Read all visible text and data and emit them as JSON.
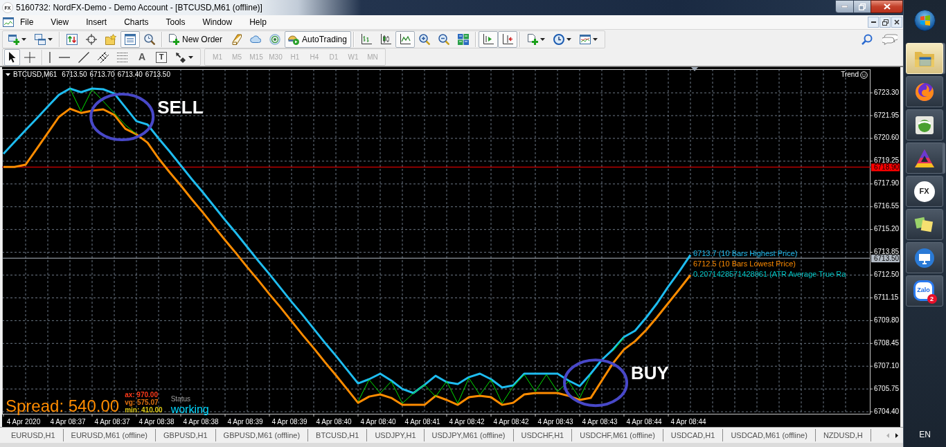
{
  "title_bar": {
    "logo_text": "FX",
    "title": "5160732: NordFX-Demo - Demo Account - [BTCUSD,M61 (offline)]"
  },
  "menu": [
    "File",
    "View",
    "Insert",
    "Charts",
    "Tools",
    "Window",
    "Help"
  ],
  "toolbar": [
    {
      "kind": "icon",
      "pressed": false,
      "dropdown": true
    },
    {
      "kind": "icon",
      "pressed": false,
      "dropdown": true
    },
    {
      "kind": "separator"
    },
    {
      "kind": "icon",
      "pressed": false
    },
    {
      "kind": "icon",
      "pressed": false
    },
    {
      "kind": "icon",
      "pressed": false
    },
    {
      "kind": "icon",
      "pressed": true
    },
    {
      "kind": "icon",
      "pressed": false
    },
    {
      "kind": "separator"
    },
    {
      "kind": "button",
      "label": "New Order",
      "pressed": false
    },
    {
      "kind": "icon",
      "pressed": false
    },
    {
      "kind": "icon",
      "pressed": false
    },
    {
      "kind": "icon",
      "pressed": false
    },
    {
      "kind": "button",
      "label": "AutoTrading",
      "pressed": true
    },
    {
      "kind": "separator"
    },
    {
      "kind": "icon",
      "pressed": false
    },
    {
      "kind": "icon",
      "pressed": false
    },
    {
      "kind": "icon",
      "pressed": true
    },
    {
      "kind": "icon",
      "pressed": false
    },
    {
      "kind": "icon",
      "pressed": false
    },
    {
      "kind": "icon",
      "pressed": false
    },
    {
      "kind": "separator"
    },
    {
      "kind": "icon",
      "pressed": true
    },
    {
      "kind": "icon",
      "pressed": true
    },
    {
      "kind": "separator"
    },
    {
      "kind": "icon",
      "pressed": false,
      "dropdown": true
    },
    {
      "kind": "icon",
      "pressed": false,
      "dropdown": true
    },
    {
      "kind": "icon",
      "pressed": false,
      "dropdown": true
    }
  ],
  "drawing_tools": [
    {
      "kind": "icon",
      "pressed": true
    },
    {
      "kind": "icon",
      "pressed": false
    },
    {
      "kind": "separator"
    },
    {
      "kind": "icon",
      "pressed": false
    },
    {
      "kind": "icon",
      "pressed": false
    },
    {
      "kind": "icon",
      "pressed": false
    },
    {
      "kind": "icon",
      "pressed": false
    },
    {
      "kind": "icon",
      "pressed": false
    },
    {
      "kind": "text",
      "label": "A",
      "pressed": false
    },
    {
      "kind": "boxed-text",
      "label": "T",
      "pressed": false
    },
    {
      "kind": "icon",
      "pressed": false,
      "dropdown": true
    }
  ],
  "timeframes": [
    {
      "label": "M1",
      "disabled": true
    },
    {
      "label": "M5",
      "disabled": true
    },
    {
      "label": "M15",
      "disabled": true
    },
    {
      "label": "M30",
      "disabled": true
    },
    {
      "label": "H1",
      "disabled": true
    },
    {
      "label": "H4",
      "disabled": true
    },
    {
      "label": "D1",
      "disabled": true
    },
    {
      "label": "W1",
      "disabled": true
    },
    {
      "label": "MN",
      "disabled": true
    }
  ],
  "chart": {
    "header": {
      "symbol": "BTCUSD,M61",
      "quotes": [
        "6713.50",
        "6713.70",
        "6713.40",
        "6713.50"
      ]
    },
    "trend_label": "Trend",
    "chart_data": {
      "type": "line",
      "grid": true,
      "categories": [
        null,
        null,
        "4 Apr 2020",
        null,
        null,
        null,
        "4 Apr 08:37",
        null,
        null,
        null,
        "4 Apr 08:37",
        null,
        null,
        null,
        "4 Apr 08:38",
        null,
        null,
        null,
        "4 Apr 08:38",
        null,
        null,
        null,
        "4 Apr 08:39",
        null,
        null,
        null,
        "4 Apr 08:39",
        null,
        null,
        null,
        "4 Apr 08:40",
        null,
        null,
        null,
        "4 Apr 08:40",
        null,
        null,
        null,
        "4 Apr 08:41",
        null,
        null,
        null,
        "4 Apr 08:42",
        null,
        null,
        null,
        "4 Apr 08:42",
        null,
        null,
        null,
        "4 Apr 08:43",
        null,
        null,
        null,
        "4 Apr 08:43",
        null,
        null,
        null,
        "4 Apr 08:44",
        null,
        null,
        null,
        "4 Apr 08:44"
      ],
      "ylim": [
        6704.28,
        6724.7
      ],
      "yticks": [
        {
          "value": 6723.3,
          "label": "6723.30"
        },
        {
          "value": 6721.95,
          "label": "6721.95"
        },
        {
          "value": 6720.6,
          "label": "6720.60"
        },
        {
          "value": 6719.25,
          "label": "6719.25"
        },
        {
          "value": 6717.9,
          "label": "6717.90"
        },
        {
          "value": 6716.55,
          "label": "6716.55"
        },
        {
          "value": 6715.2,
          "label": "6715.20"
        },
        {
          "value": 6713.85,
          "label": "6713.85"
        },
        {
          "value": 6712.5,
          "label": "6712.50"
        },
        {
          "value": 6711.15,
          "label": "6711.15"
        },
        {
          "value": 6709.8,
          "label": "6709.80"
        },
        {
          "value": 6708.45,
          "label": "6708.45"
        },
        {
          "value": 6707.1,
          "label": "6707.10"
        },
        {
          "value": 6705.75,
          "label": "6705.75"
        },
        {
          "value": 6704.4,
          "label": "6704.40"
        }
      ],
      "series": [
        {
          "color": "#1ebcf0",
          "values": [
            6719.69,
            6720.39,
            6721.09,
            6721.78,
            6722.48,
            6723.18,
            6723.55,
            6723.34,
            6723.55,
            6723.51,
            6723.26,
            6722.44,
            6721.62,
            6721.42,
            6720.6,
            6719.82,
            6719.0,
            6718.18,
            6717.4,
            6716.58,
            6715.76,
            6714.98,
            6714.16,
            6713.34,
            6712.56,
            6711.74,
            6710.92,
            6710.14,
            6709.32,
            6708.5,
            6707.72,
            6706.9,
            6706.08,
            6706.33,
            6706.66,
            6706.25,
            6705.75,
            6705.51,
            6706.0,
            6706.53,
            6706.16,
            6706.04,
            6706.45,
            6706.66,
            6706.33,
            6705.84,
            6705.96,
            6706.66,
            6706.66,
            6706.66,
            6706.66,
            6706.25,
            6705.92,
            6706.66,
            6707.48,
            6708.09,
            6708.83,
            6709.2,
            6709.98,
            6710.84,
            6711.82,
            6712.72,
            6713.7
          ]
        },
        {
          "color": "#ff8c00",
          "values": [
            6718.91,
            6718.91,
            6719.04,
            6719.98,
            6720.92,
            6721.87,
            6722.36,
            6722.11,
            6722.24,
            6722.32,
            6721.99,
            6721.17,
            6720.84,
            6720.35,
            6719.41,
            6718.59,
            6717.81,
            6716.99,
            6716.21,
            6715.39,
            6714.57,
            6713.79,
            6712.97,
            6712.19,
            6711.37,
            6710.59,
            6709.77,
            6708.95,
            6708.17,
            6707.35,
            6706.57,
            6705.75,
            6704.93,
            6705.3,
            6705.43,
            6705.22,
            6704.81,
            6704.81,
            6704.81,
            6705.34,
            6705.1,
            6704.81,
            6705.26,
            6705.34,
            6705.26,
            6704.81,
            6704.93,
            6705.43,
            6705.51,
            6705.51,
            6705.51,
            6705.34,
            6705.1,
            6705.22,
            6706.25,
            6707.27,
            6708.09,
            6708.58,
            6709.24,
            6710.02,
            6710.84,
            6711.66,
            6712.5
          ]
        },
        {
          "color": "#00e000",
          "values": [
            null,
            null,
            null,
            null,
            null,
            null,
            6723.55,
            6722.2,
            6723.5,
            6722.8,
            6722.1,
            6721.4,
            6720.84,
            null,
            null,
            null,
            null,
            null,
            null,
            null,
            null,
            null,
            null,
            null,
            null,
            null,
            null,
            null,
            null,
            null,
            null,
            null,
            6705.0,
            6706.3,
            6705.5,
            6706.2,
            6704.9,
            6705.5,
            6706.0,
            6705.3,
            6706.2,
            6704.9,
            6706.4,
            6705.4,
            6706.3,
            6704.9,
            6705.9,
            6706.6,
            6705.6,
            6706.6,
            6705.6,
            6706.2,
            6705.2,
            6706.6,
            null,
            6708.0,
            6708.8,
            null,
            null,
            null,
            null,
            null,
            null
          ]
        }
      ],
      "ref_lines": [
        {
          "axis": "y",
          "value": 6718.9,
          "label": "6718.90",
          "color": "#ff0000"
        },
        {
          "axis": "y",
          "value": 6713.5,
          "label": "6713.50",
          "color": "#b4bcc6"
        }
      ],
      "annotations": [
        "SELL",
        "BUY"
      ]
    },
    "indicator_labels": [
      {
        "text": "6713.7 (10 Bars Highest Price)",
        "color": "#1ebcf0"
      },
      {
        "text": "6712.5 (10 Bars Lowest Price)",
        "color": "#ff8c00"
      },
      {
        "text": "0.2071428571428961 (ATR Average True Ra",
        "color": "#00c4c4"
      }
    ],
    "spread": {
      "text": "Spread: 540.00",
      "stats": [
        {
          "text": "ax: 970.00",
          "color": "#ff3a1a"
        },
        {
          "text": "vg: 575.07",
          "color": "#e07010"
        },
        {
          "text": "min: 410.00",
          "color": "#dcc814"
        }
      ],
      "status_label": "Status",
      "status": "working"
    }
  },
  "tabs": [
    {
      "label": "EURUSD,H1",
      "selected": false
    },
    {
      "label": "EURUSD,M61 (offline)",
      "selected": false
    },
    {
      "label": "GBPUSD,H1",
      "selected": false
    },
    {
      "label": "GBPUSD,M61 (offline)",
      "selected": false
    },
    {
      "label": "BTCUSD,H1",
      "selected": false
    },
    {
      "label": "USDJPY,H1",
      "selected": false
    },
    {
      "label": "USDJPY,M61 (offline)",
      "selected": false
    },
    {
      "label": "USDCHF,H1",
      "selected": false
    },
    {
      "label": "USDCHF,M61 (offline)",
      "selected": false
    },
    {
      "label": "USDCAD,H1",
      "selected": false
    },
    {
      "label": "USDCAD,M61 (offline)",
      "selected": false
    },
    {
      "label": "NZDUSD,H",
      "selected": false
    }
  ],
  "tab_scroll": {
    "back_disabled": true,
    "forward_disabled": false
  },
  "taskbar": {
    "apps": [
      {
        "active": true,
        "stacked": true
      },
      {
        "active": false
      },
      {
        "active": false
      },
      {
        "active": false,
        "stacked": true
      },
      {
        "active": false,
        "logo_text": "FX"
      },
      {
        "active": false
      },
      {
        "active": false
      },
      {
        "active": false,
        "logo_text": "Zalo",
        "badge": "2"
      }
    ],
    "language": "EN"
  }
}
